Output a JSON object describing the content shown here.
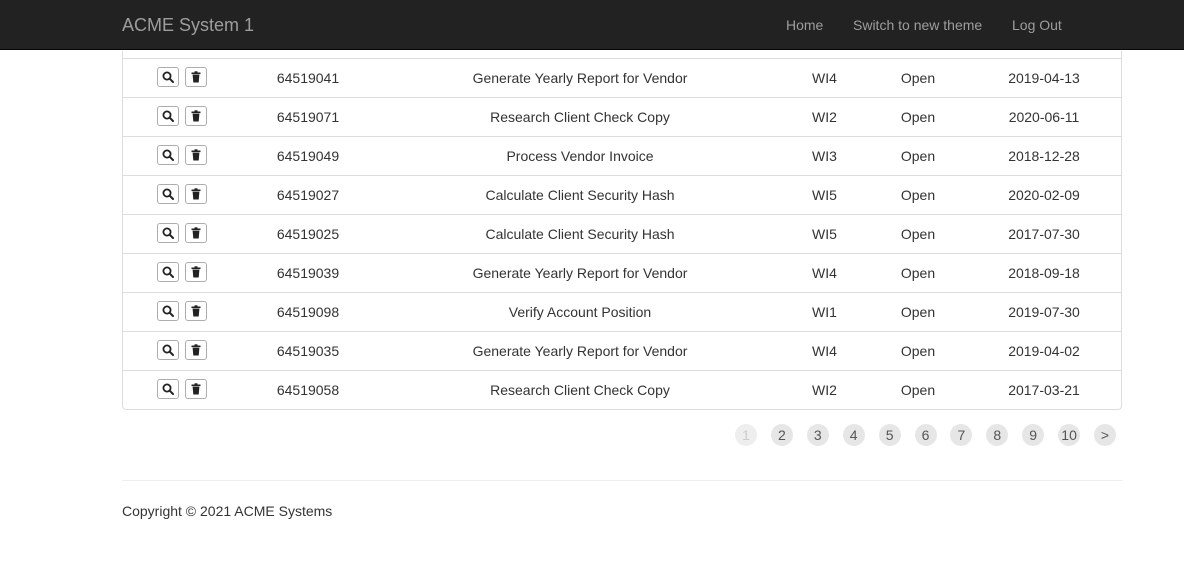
{
  "app": {
    "title": "ACME System 1"
  },
  "nav": {
    "home": "Home",
    "theme": "Switch to new theme",
    "logout": "Log Out"
  },
  "table": {
    "rows": [
      {
        "id": "64519041",
        "description": "Generate Yearly Report for Vendor",
        "type": "WI4",
        "status": "Open",
        "date": "2019-04-13"
      },
      {
        "id": "64519071",
        "description": "Research Client Check Copy",
        "type": "WI2",
        "status": "Open",
        "date": "2020-06-11"
      },
      {
        "id": "64519049",
        "description": "Process Vendor Invoice",
        "type": "WI3",
        "status": "Open",
        "date": "2018-12-28"
      },
      {
        "id": "64519027",
        "description": "Calculate Client Security Hash",
        "type": "WI5",
        "status": "Open",
        "date": "2020-02-09"
      },
      {
        "id": "64519025",
        "description": "Calculate Client Security Hash",
        "type": "WI5",
        "status": "Open",
        "date": "2017-07-30"
      },
      {
        "id": "64519039",
        "description": "Generate Yearly Report for Vendor",
        "type": "WI4",
        "status": "Open",
        "date": "2018-09-18"
      },
      {
        "id": "64519098",
        "description": "Verify Account Position",
        "type": "WI1",
        "status": "Open",
        "date": "2019-07-30"
      },
      {
        "id": "64519035",
        "description": "Generate Yearly Report for Vendor",
        "type": "WI4",
        "status": "Open",
        "date": "2019-04-02"
      },
      {
        "id": "64519058",
        "description": "Research Client Check Copy",
        "type": "WI2",
        "status": "Open",
        "date": "2017-03-21"
      }
    ],
    "row_icons": [
      "search-icon",
      "trash-icon"
    ]
  },
  "pagination": {
    "pages": [
      "1",
      "2",
      "3",
      "4",
      "5",
      "6",
      "7",
      "8",
      "9",
      "10",
      ">"
    ],
    "current": "1"
  },
  "footer": {
    "copyright": "Copyright © 2021 ACME Systems"
  },
  "colors": {
    "navbar": "#222222",
    "nav_text": "#9d9d9d",
    "border": "#dddddd"
  }
}
